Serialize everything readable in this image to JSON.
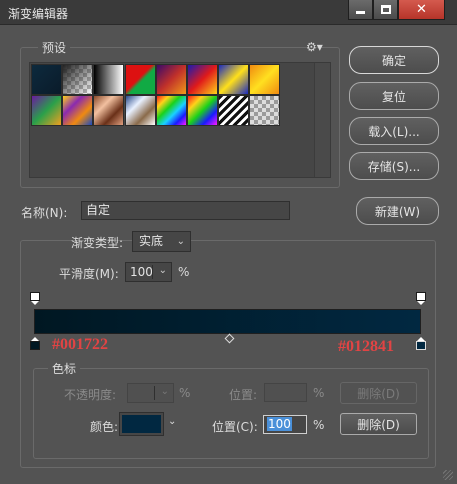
{
  "window": {
    "title": "渐变编辑器",
    "close_symbol": "✕"
  },
  "presets": {
    "legend": "预设",
    "menu_icon": "gear-icon",
    "swatches": [
      {
        "name": "foreground-to-background",
        "css": "linear-gradient(135deg,#0d2a3d,#0a1b2a)"
      },
      {
        "name": "foreground-to-transparent",
        "css": "linear-gradient(135deg,#222 0%,rgba(0,0,0,0) 100%),repeating-conic-gradient(#bbb 0 25%,#fff 0 50%) 0 0/8px 8px"
      },
      {
        "name": "black-white",
        "css": "linear-gradient(90deg,#000,#fff)"
      },
      {
        "name": "red-green",
        "css": "linear-gradient(135deg,#d11 0%,#d11 45%,#1a4 55%,#1a4 100%)"
      },
      {
        "name": "violet-orange",
        "css": "linear-gradient(135deg,#3a0a6a,#c0302a,#f29a1a)"
      },
      {
        "name": "blue-red-yellow",
        "css": "linear-gradient(135deg,#1a1ab0,#e01a1a,#ffd21a)"
      },
      {
        "name": "blue-yellow-blue",
        "css": "linear-gradient(135deg,#1a2ac0,#ffe01a,#1a2ac0)"
      },
      {
        "name": "orange-yellow-orange",
        "css": "linear-gradient(135deg,#f08a10,#ffe020,#f08a10)"
      },
      {
        "name": "violet-green-orange",
        "css": "linear-gradient(135deg,#6a1aa0,#2aa04a,#f0a020)"
      },
      {
        "name": "yellow-violet-orange-blue",
        "css": "linear-gradient(135deg,#ffd21a,#8a2ab0,#f08a10,#1a4ac0)"
      },
      {
        "name": "copper",
        "css": "linear-gradient(135deg,#8a4a2a,#f2c0a0,#6a3018,#e0a080)"
      },
      {
        "name": "chrome",
        "css": "linear-gradient(135deg,#2a4a8a,#e8f0ff,#8a6a4a,#ffffff)"
      },
      {
        "name": "spectrum",
        "css": "linear-gradient(135deg,#ff1a1a,#ffd21a,#1ad21a,#1ad2ff,#1a1aff,#ff1aff)"
      },
      {
        "name": "transparent-rainbow",
        "css": "linear-gradient(135deg,#ff1a1a,#ffd21a,#1ad21a,#1a1aff,#ff1aff),repeating-conic-gradient(#bbb 0 25%,#fff 0 50%) 0 0/8px 8px"
      },
      {
        "name": "transparent-stripes",
        "css": "repeating-linear-gradient(135deg,#111 0 3px,#fff 3px 6px)"
      },
      {
        "name": "neutral-density",
        "css": "repeating-conic-gradient(#9a9a9a 0 25%,#dcdcdc 0 50%) 0 0/8px 8px"
      }
    ]
  },
  "buttons": {
    "ok": "确定",
    "reset": "复位",
    "load": "载入(L)...",
    "save": "存储(S)...",
    "new": "新建(W)"
  },
  "name_field": {
    "label": "名称(N):",
    "value": "自定"
  },
  "gradient": {
    "type_label": "渐变类型:",
    "type_value": "实底",
    "smooth_label": "平滑度(M):",
    "smooth_value": "100",
    "smooth_unit": "%",
    "start_color": "#001722",
    "end_color": "#012841"
  },
  "annotations": {
    "left_color": "#001722",
    "right_color": "#012841"
  },
  "stops": {
    "legend": "色标",
    "opacity_label": "不透明度:",
    "opacity_unit": "%",
    "opacity_location_label": "位置:",
    "opacity_location_unit": "%",
    "opacity_delete": "删除(D)",
    "color_label": "颜色:",
    "color_value": "#012841",
    "color_location_label": "位置(C):",
    "color_location_value": "100",
    "color_location_unit": "%",
    "color_delete": "删除(D)"
  }
}
